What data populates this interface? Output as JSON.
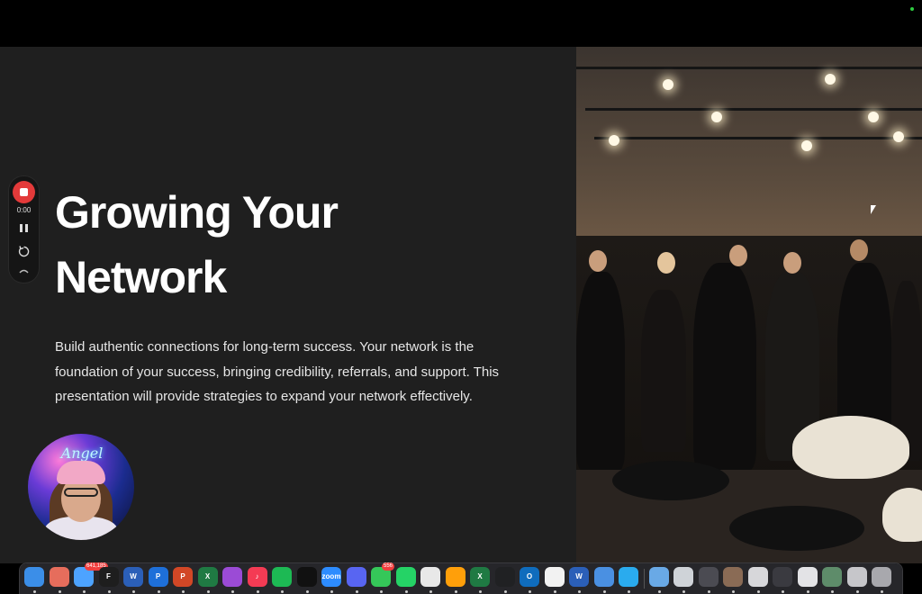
{
  "slide": {
    "title_line1": "Growing Your",
    "title_line2": "Network",
    "body": "Build authentic connections for long-term success. Your network is the foundation of your success, bringing credibility, referrals, and support. This presentation will provide strategies to expand your network effectively."
  },
  "recorder": {
    "timer": "0:00"
  },
  "webcam": {
    "neon_sign": "Angel"
  },
  "dock": {
    "items": [
      {
        "name": "finder",
        "color": "#3b8ee8",
        "label": ""
      },
      {
        "name": "launchpad",
        "color": "#e66d5c",
        "label": ""
      },
      {
        "name": "mail",
        "color": "#4da3ff",
        "label": "",
        "badge": "641,185"
      },
      {
        "name": "figma",
        "color": "#1e1e1e",
        "label": "F"
      },
      {
        "name": "word",
        "color": "#2b5fb8",
        "label": "W"
      },
      {
        "name": "tasks",
        "color": "#1e6fd9",
        "label": "P"
      },
      {
        "name": "powerpoint",
        "color": "#d24726",
        "label": "P"
      },
      {
        "name": "excel",
        "color": "#1f7a43",
        "label": "X"
      },
      {
        "name": "podcasts",
        "color": "#9b4bd6",
        "label": ""
      },
      {
        "name": "music",
        "color": "#f43b54",
        "label": "♪"
      },
      {
        "name": "spotify",
        "color": "#1db954",
        "label": ""
      },
      {
        "name": "voice-app",
        "color": "#111111",
        "label": ""
      },
      {
        "name": "zoom",
        "color": "#2d8cff",
        "label": "zoom"
      },
      {
        "name": "discord",
        "color": "#5865f2",
        "label": ""
      },
      {
        "name": "messages",
        "color": "#35c759",
        "label": "",
        "badge": "556"
      },
      {
        "name": "whatsapp",
        "color": "#25d366",
        "label": ""
      },
      {
        "name": "chrome",
        "color": "#e8e8e8",
        "label": ""
      },
      {
        "name": "books",
        "color": "#ff9f0a",
        "label": ""
      },
      {
        "name": "excel-2",
        "color": "#1f7a43",
        "label": "X"
      },
      {
        "name": "chatgpt",
        "color": "#202123",
        "label": ""
      },
      {
        "name": "outlook",
        "color": "#0f6cbd",
        "label": "O"
      },
      {
        "name": "notes-app",
        "color": "#f2f2f2",
        "label": ""
      },
      {
        "name": "word-2",
        "color": "#2b5fb8",
        "label": "W"
      },
      {
        "name": "docs-app",
        "color": "#4a90e2",
        "label": ""
      },
      {
        "name": "telegram",
        "color": "#2aabee",
        "label": ""
      },
      {
        "name": "folder",
        "color": "#69a9e6",
        "label": ""
      },
      {
        "name": "window-1",
        "color": "#cfd3d8",
        "label": ""
      },
      {
        "name": "window-2",
        "color": "#4b4b52",
        "label": ""
      },
      {
        "name": "window-3",
        "color": "#8a6b55",
        "label": ""
      },
      {
        "name": "window-4",
        "color": "#d7d7da",
        "label": ""
      },
      {
        "name": "window-5",
        "color": "#3a3a40",
        "label": ""
      },
      {
        "name": "window-6",
        "color": "#e3e3e6",
        "label": ""
      },
      {
        "name": "window-7",
        "color": "#5e8c6a",
        "label": ""
      },
      {
        "name": "window-8",
        "color": "#c6c6ca",
        "label": ""
      },
      {
        "name": "trash",
        "color": "#a8a8ad",
        "label": ""
      }
    ]
  }
}
